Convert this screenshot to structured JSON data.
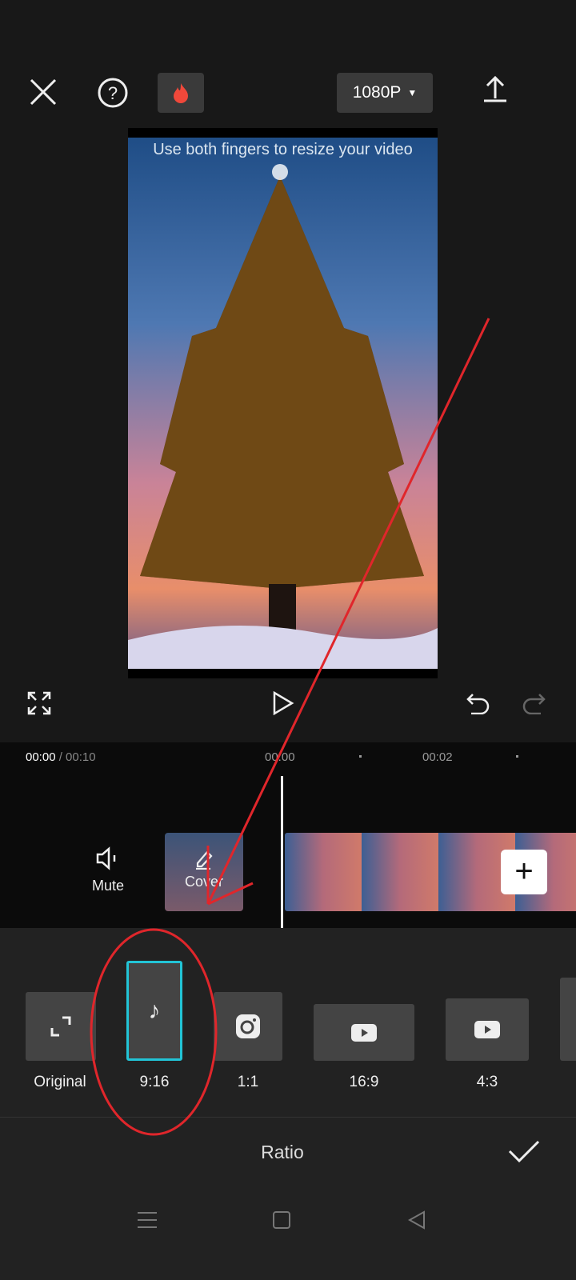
{
  "topbar": {
    "close_icon": "close-icon",
    "help_icon": "help-icon",
    "fire_icon": "fire-icon",
    "resolution": "1080P",
    "export_icon": "upload-icon"
  },
  "preview": {
    "hint": "Use both fingers to resize your video"
  },
  "controls": {
    "fullscreen_icon": "fullscreen-icon",
    "play_icon": "play-icon",
    "undo_icon": "undo-icon",
    "redo_icon": "redo-icon"
  },
  "timeline": {
    "current": "00:00",
    "total": "/ 00:10",
    "ticks": [
      "00:00",
      "00:02"
    ],
    "mute_label": "Mute",
    "cover_label": "Cover"
  },
  "ratios": {
    "items": [
      {
        "label": "Original"
      },
      {
        "label": "9:16",
        "selected": true
      },
      {
        "label": "1:1"
      },
      {
        "label": "16:9"
      },
      {
        "label": "4:3"
      }
    ]
  },
  "footer": {
    "title": "Ratio"
  },
  "colors": {
    "accent": "#22c4d6",
    "annotation": "#e0262b"
  }
}
